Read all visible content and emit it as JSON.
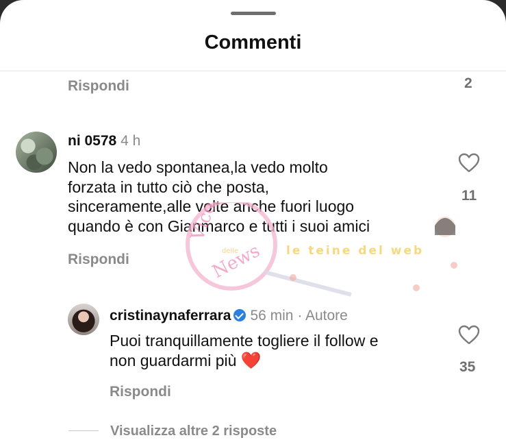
{
  "sheet": {
    "title": "Commenti"
  },
  "previous_comment": {
    "reply_label": "Rispondi",
    "like_count": "2"
  },
  "comment": {
    "username": "ni     0578",
    "time": "4 h",
    "text_lines": [
      "Non la vedo spontanea,la vedo molto",
      "forzata in tutto ciò che posta,",
      "sinceramente,alle volte anche fuori luogo",
      "quando è con Gianmarco e tutti i suoi amici"
    ],
    "like_count": "11",
    "reply_label": "Rispondi"
  },
  "reply": {
    "username": "cristinaynaferrara",
    "time": "56 min",
    "author_badge": "· Autore",
    "text_line1": "Puoi tranquillamente togliere il follow e",
    "text_line2": "non guardarmi più",
    "emoji": "❤️",
    "like_count": "35",
    "reply_label": "Rispondi"
  },
  "view_more": {
    "label": "Visualizza altre 2 risposte"
  },
  "watermark": {
    "text1": "Vicolo delle News",
    "text2": "le teine del web"
  },
  "colors": {
    "accent_blue": "#2b7fe0",
    "heart_red": "#e02626",
    "muted_grey": "#8a8a8a"
  },
  "icons": [
    "heart-outline-icon",
    "verified-badge-icon",
    "red-heart-emoji"
  ]
}
